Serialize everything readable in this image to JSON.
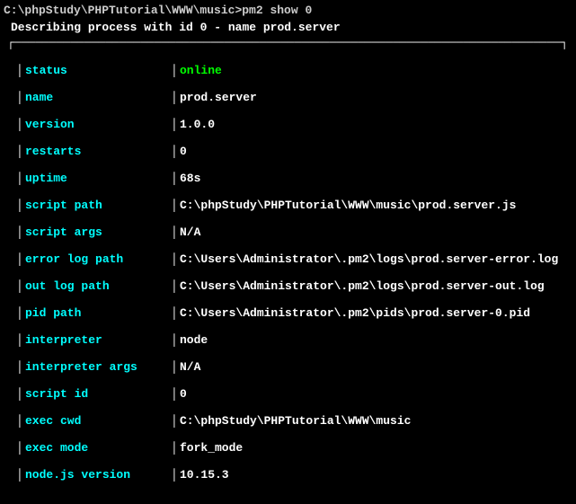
{
  "prompt": "C:\\phpStudy\\PHPTutorial\\WWW\\music>pm2 show 0",
  "description": "Describing process with id 0 - name prod.server",
  "top_border": "┌──────────────────────────────────────────────────────────────────────────────┐",
  "rows": [
    {
      "key": "status",
      "value": "online",
      "online": true
    },
    {
      "key": "name",
      "value": "prod.server"
    },
    {
      "key": "version",
      "value": "1.0.0"
    },
    {
      "key": "restarts",
      "value": "0"
    },
    {
      "key": "uptime",
      "value": "68s"
    },
    {
      "key": "script path",
      "value": "C:\\phpStudy\\PHPTutorial\\WWW\\music\\prod.server.js"
    },
    {
      "key": "script args",
      "value": "N/A"
    },
    {
      "key": "error log path",
      "value": "C:\\Users\\Administrator\\.pm2\\logs\\prod.server-error.log"
    },
    {
      "key": "out log path",
      "value": "C:\\Users\\Administrator\\.pm2\\logs\\prod.server-out.log"
    },
    {
      "key": "pid path",
      "value": "C:\\Users\\Administrator\\.pm2\\pids\\prod.server-0.pid"
    },
    {
      "key": "interpreter",
      "value": "node"
    },
    {
      "key": "interpreter args",
      "value": "N/A"
    },
    {
      "key": "script id",
      "value": "0"
    },
    {
      "key": "exec cwd",
      "value": "C:\\phpStudy\\PHPTutorial\\WWW\\music"
    },
    {
      "key": "exec mode",
      "value": "fork_mode"
    },
    {
      "key": "node.js version",
      "value": "10.15.3"
    }
  ]
}
